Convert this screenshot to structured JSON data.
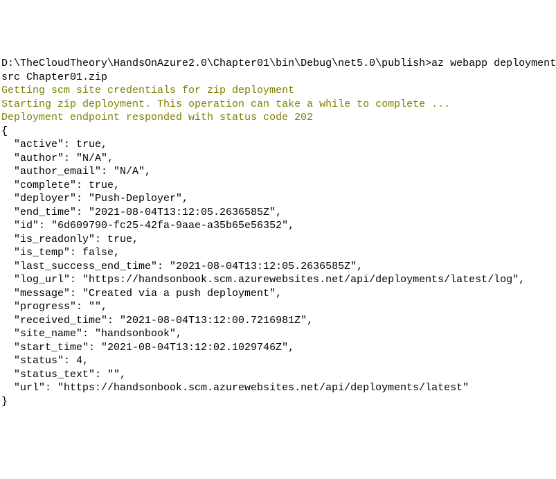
{
  "prompt": {
    "line1": "D:\\TheCloudTheory\\HandsOnAzure2.0\\Chapter01\\bin\\Debug\\net5.0\\publish>az webapp deployment",
    "line2": "src Chapter01.zip"
  },
  "status": {
    "line1": "Getting scm site credentials for zip deployment",
    "line2": "Starting zip deployment. This operation can take a while to complete ...",
    "line3": "Deployment endpoint responded with status code 202"
  },
  "json": {
    "open": "{",
    "fields": [
      "  \"active\": true,",
      "  \"author\": \"N/A\",",
      "  \"author_email\": \"N/A\",",
      "  \"complete\": true,",
      "  \"deployer\": \"Push-Deployer\",",
      "  \"end_time\": \"2021-08-04T13:12:05.2636585Z\",",
      "  \"id\": \"6d609790-fc25-42fa-9aae-a35b65e56352\",",
      "  \"is_readonly\": true,",
      "  \"is_temp\": false,",
      "  \"last_success_end_time\": \"2021-08-04T13:12:05.2636585Z\",",
      "  \"log_url\": \"https://handsonbook.scm.azurewebsites.net/api/deployments/latest/log\",",
      "  \"message\": \"Created via a push deployment\",",
      "  \"progress\": \"\",",
      "  \"received_time\": \"2021-08-04T13:12:00.7216981Z\",",
      "  \"site_name\": \"handsonbook\",",
      "  \"start_time\": \"2021-08-04T13:12:02.1029746Z\",",
      "  \"status\": 4,",
      "  \"status_text\": \"\",",
      "  \"url\": \"https://handsonbook.scm.azurewebsites.net/api/deployments/latest\""
    ],
    "close": "}"
  }
}
